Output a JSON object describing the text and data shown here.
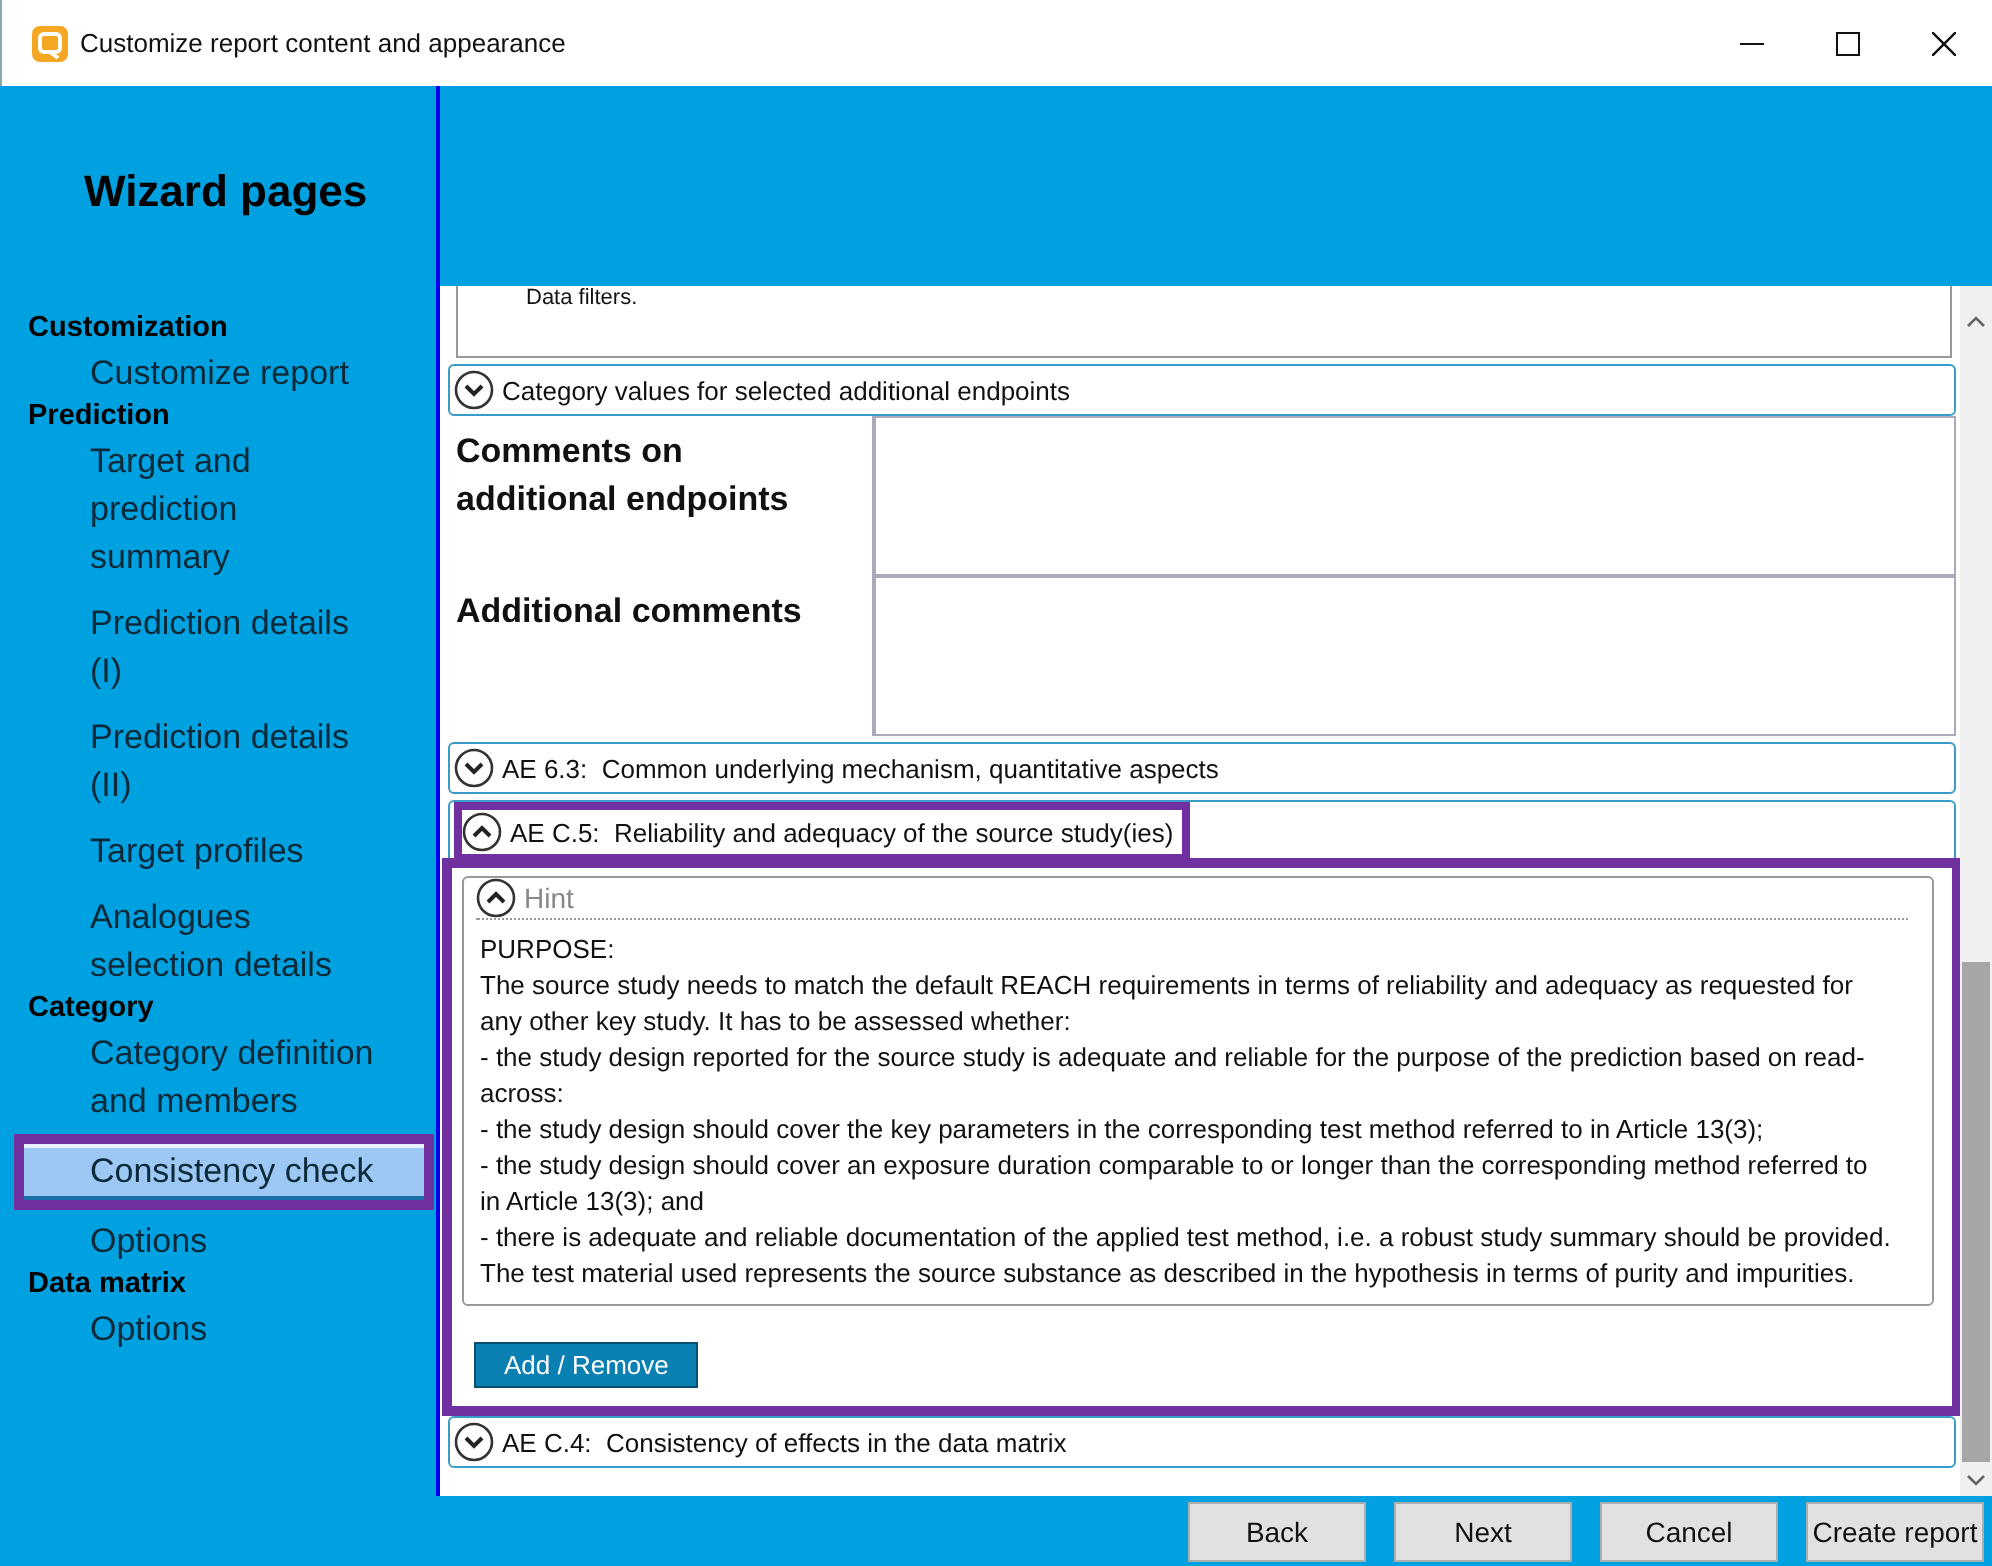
{
  "window": {
    "title": "Customize report content and appearance"
  },
  "sidebar": {
    "title": "Wizard pages",
    "groups": [
      {
        "label": "Customization",
        "items": [
          {
            "label": "Customize report",
            "selected": false,
            "highlighted": false
          }
        ]
      },
      {
        "label": "Prediction",
        "items": [
          {
            "label": "Target and prediction summary",
            "selected": false,
            "highlighted": false
          },
          {
            "label": "Prediction details (I)",
            "selected": false,
            "highlighted": false
          },
          {
            "label": "Prediction details (II)",
            "selected": false,
            "highlighted": false
          },
          {
            "label": "Target profiles",
            "selected": false,
            "highlighted": false
          },
          {
            "label": "Analogues selection details",
            "selected": false,
            "highlighted": false
          }
        ]
      },
      {
        "label": "Category",
        "items": [
          {
            "label": "Category definition and members",
            "selected": false,
            "highlighted": false
          },
          {
            "label": "Consistency check",
            "selected": true,
            "highlighted": true
          },
          {
            "label": "Options",
            "selected": false,
            "highlighted": false
          }
        ]
      },
      {
        "label": "Data matrix",
        "items": [
          {
            "label": "Options",
            "selected": false,
            "highlighted": false
          }
        ]
      }
    ]
  },
  "content": {
    "top_fragment": "Data filters.",
    "sections": [
      {
        "kind": "header",
        "title": "Category values for selected additional endpoints",
        "expanded": false
      },
      {
        "kind": "fields",
        "fields": [
          {
            "label": "Comments on additional endpoints"
          },
          {
            "label": "Additional comments"
          }
        ]
      },
      {
        "kind": "header",
        "title": "AE 6.3:  Common underlying mechanism, quantitative aspects",
        "expanded": false
      },
      {
        "kind": "header",
        "title": "AE C.5:  Reliability and adequacy of the source study(ies)",
        "expanded": true,
        "highlighted": true,
        "body_highlighted": true,
        "button": "Add / Remove",
        "hint": {
          "title": "Hint",
          "expanded": true,
          "lines": [
            "PURPOSE:",
            "The source study needs to match the default REACH requirements in terms of reliability and adequacy as requested for any other key study. It has to be assessed whether:",
            "- the study design reported for the source study is adequate and reliable for the purpose of the prediction based on read-across:",
            "- the study design should cover the key parameters in the corresponding test method referred to in Article 13(3);",
            "- the study design should cover an exposure duration comparable to or longer than the corresponding method referred to in Article 13(3); and",
            "- there is adequate and reliable documentation of the applied test method, i.e. a robust study summary should be provided. The test material used represents the source substance as described in the hypothesis in terms of purity and impurities."
          ]
        }
      },
      {
        "kind": "header",
        "title": "AE C.4:  Consistency of effects in the data matrix",
        "expanded": false
      }
    ]
  },
  "buttons": [
    "Back",
    "Next",
    "Cancel",
    "Create report"
  ]
}
